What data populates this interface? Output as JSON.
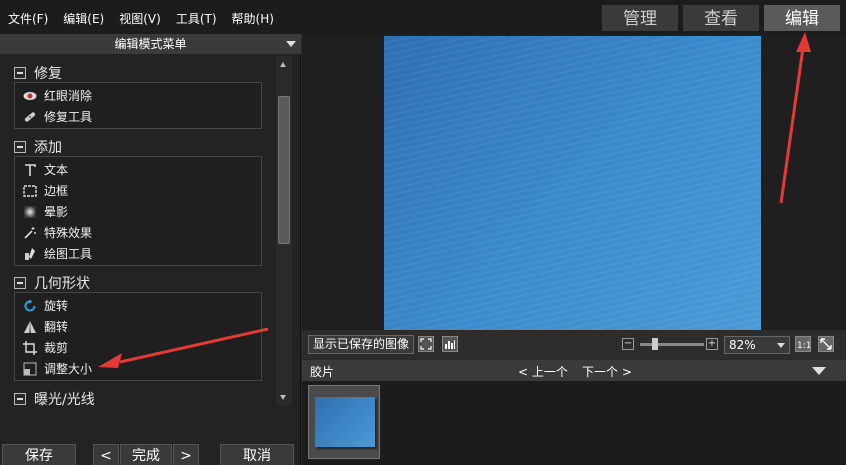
{
  "menu": [
    "文件(F)",
    "编辑(E)",
    "视图(V)",
    "工具(T)",
    "帮助(H)"
  ],
  "modes": [
    "管理",
    "查看",
    "编辑"
  ],
  "panel": {
    "title": "编辑模式菜单"
  },
  "groups": {
    "repair": {
      "title": "修复",
      "items": [
        "红眼消除",
        "修复工具"
      ]
    },
    "add": {
      "title": "添加",
      "items": [
        "文本",
        "边框",
        "晕影",
        "特殊效果",
        "绘图工具"
      ]
    },
    "geometry": {
      "title": "几何形状",
      "items": [
        "旋转",
        "翻转",
        "裁剪",
        "调整大小"
      ]
    },
    "exposure": {
      "title": "曝光/光线"
    }
  },
  "buttons": {
    "save": "保存",
    "prev": "<",
    "done": "完成",
    "next": ">",
    "cancel": "取消"
  },
  "toolbar": {
    "show_saved": "显示已保存的图像",
    "zoom": "82%"
  },
  "film": {
    "title": "胶片",
    "prev": "< 上一个",
    "next": "下一个 >"
  },
  "colors": {
    "annotation_arrow": "#e53935",
    "accent_blue": "#3b8ccd"
  }
}
